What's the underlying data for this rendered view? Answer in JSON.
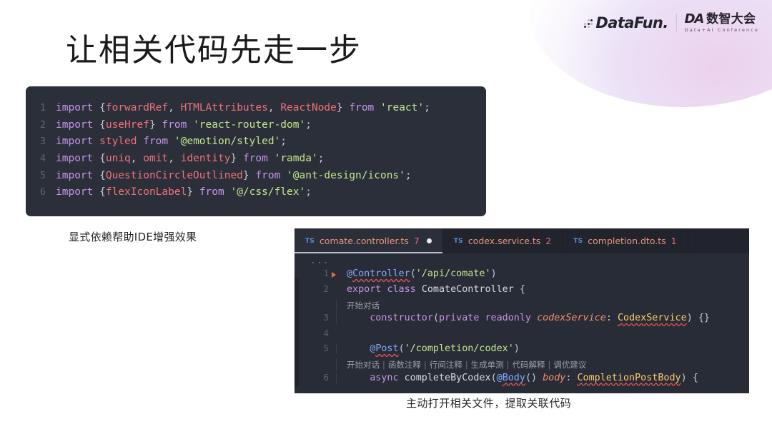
{
  "brand": {
    "datafun_name": "DataFun.",
    "da_mark": "DA",
    "da_cn": "数智大会",
    "da_sub": "Data+AI Conference"
  },
  "slide": {
    "title": "让相关代码先走一步",
    "caption_top": "显式依赖帮助IDE增强效果",
    "caption_bottom": "主动打开相关文件，提取关联代码"
  },
  "code_block_top": {
    "lines": [
      {
        "number": "1",
        "tokens": [
          {
            "text": "import ",
            "cls": "t-kw"
          },
          {
            "text": "{",
            "cls": "t-pun"
          },
          {
            "text": "forwardRef",
            "cls": "t-id"
          },
          {
            "text": ", ",
            "cls": "t-pun"
          },
          {
            "text": "HTMLAttributes",
            "cls": "t-id"
          },
          {
            "text": ", ",
            "cls": "t-pun"
          },
          {
            "text": "ReactNode",
            "cls": "t-id"
          },
          {
            "text": "} ",
            "cls": "t-pun"
          },
          {
            "text": "from ",
            "cls": "t-kw"
          },
          {
            "text": "'react'",
            "cls": "t-str"
          },
          {
            "text": ";",
            "cls": "t-pun"
          }
        ]
      },
      {
        "number": "2",
        "tokens": [
          {
            "text": "import ",
            "cls": "t-kw"
          },
          {
            "text": "{",
            "cls": "t-pun"
          },
          {
            "text": "useHref",
            "cls": "t-id"
          },
          {
            "text": "} ",
            "cls": "t-pun"
          },
          {
            "text": "from ",
            "cls": "t-kw"
          },
          {
            "text": "'react-router-dom'",
            "cls": "t-str"
          },
          {
            "text": ";",
            "cls": "t-pun"
          }
        ]
      },
      {
        "number": "3",
        "tokens": [
          {
            "text": "import ",
            "cls": "t-kw"
          },
          {
            "text": "styled ",
            "cls": "t-id"
          },
          {
            "text": "from ",
            "cls": "t-kw"
          },
          {
            "text": "'@emotion/styled'",
            "cls": "t-str"
          },
          {
            "text": ";",
            "cls": "t-pun"
          }
        ]
      },
      {
        "number": "4",
        "tokens": [
          {
            "text": "import ",
            "cls": "t-kw"
          },
          {
            "text": "{",
            "cls": "t-pun"
          },
          {
            "text": "uniq",
            "cls": "t-id"
          },
          {
            "text": ", ",
            "cls": "t-pun"
          },
          {
            "text": "omit",
            "cls": "t-id"
          },
          {
            "text": ", ",
            "cls": "t-pun"
          },
          {
            "text": "identity",
            "cls": "t-id"
          },
          {
            "text": "} ",
            "cls": "t-pun"
          },
          {
            "text": "from ",
            "cls": "t-kw"
          },
          {
            "text": "'ramda'",
            "cls": "t-str"
          },
          {
            "text": ";",
            "cls": "t-pun"
          }
        ]
      },
      {
        "number": "5",
        "tokens": [
          {
            "text": "import ",
            "cls": "t-kw"
          },
          {
            "text": "{",
            "cls": "t-pun"
          },
          {
            "text": "QuestionCircleOutlined",
            "cls": "t-id"
          },
          {
            "text": "} ",
            "cls": "t-pun"
          },
          {
            "text": "from ",
            "cls": "t-kw"
          },
          {
            "text": "'@ant-design/icons'",
            "cls": "t-str"
          },
          {
            "text": ";",
            "cls": "t-pun"
          }
        ]
      },
      {
        "number": "6",
        "tokens": [
          {
            "text": "import ",
            "cls": "t-kw"
          },
          {
            "text": "{",
            "cls": "t-pun"
          },
          {
            "text": "flexIconLabel",
            "cls": "t-id"
          },
          {
            "text": "} ",
            "cls": "t-pun"
          },
          {
            "text": "from ",
            "cls": "t-kw"
          },
          {
            "text": "'@/css/flex'",
            "cls": "t-str"
          },
          {
            "text": ";",
            "cls": "t-pun"
          }
        ]
      }
    ]
  },
  "editor": {
    "tabs": [
      {
        "badge": "TS",
        "name": "comate.controller.ts",
        "count": "7",
        "active": true,
        "dirty": true
      },
      {
        "badge": "TS",
        "name": "codex.service.ts",
        "count": "2",
        "active": false,
        "dirty": false
      },
      {
        "badge": "TS",
        "name": "completion.dto.ts",
        "count": "1",
        "active": false,
        "dirty": false
      }
    ],
    "ellipsis": "...",
    "rows": [
      {
        "kind": "code",
        "number": "1",
        "guide": false,
        "tokens": [
          {
            "text": "@",
            "cls": "t-dec"
          },
          {
            "text": "Controller",
            "cls": "t-dec squiggle"
          },
          {
            "text": "(",
            "cls": "t-pun"
          },
          {
            "text": "'/api/comate'",
            "cls": "t-str"
          },
          {
            "text": ")",
            "cls": "t-pun"
          }
        ]
      },
      {
        "kind": "code",
        "number": "2",
        "guide": false,
        "tokens": [
          {
            "text": "export ",
            "cls": "t-kw"
          },
          {
            "text": "class ",
            "cls": "t-kw"
          },
          {
            "text": "ComateController ",
            "cls": "t-plain"
          },
          {
            "text": "{",
            "cls": "t-pun"
          }
        ]
      },
      {
        "kind": "lens",
        "number": "",
        "items": [
          "开始对话"
        ]
      },
      {
        "kind": "code",
        "number": "3",
        "guide": true,
        "tokens": [
          {
            "text": "    ",
            "cls": "t-pun"
          },
          {
            "text": "constructor",
            "cls": "t-mod"
          },
          {
            "text": "(",
            "cls": "t-pun"
          },
          {
            "text": "private ",
            "cls": "t-kw"
          },
          {
            "text": "readonly ",
            "cls": "t-kw"
          },
          {
            "text": "codexService",
            "cls": "t-par"
          },
          {
            "text": ": ",
            "cls": "t-pun"
          },
          {
            "text": "CodexService",
            "cls": "t-cls squiggle"
          },
          {
            "text": ") ",
            "cls": "t-pun"
          },
          {
            "text": "{}",
            "cls": "t-pun"
          }
        ]
      },
      {
        "kind": "code",
        "number": "4",
        "guide": true,
        "tokens": []
      },
      {
        "kind": "code",
        "number": "5",
        "guide": true,
        "tokens": [
          {
            "text": "    ",
            "cls": "t-pun"
          },
          {
            "text": "@",
            "cls": "t-dec"
          },
          {
            "text": "Post",
            "cls": "t-dec squiggle"
          },
          {
            "text": "(",
            "cls": "t-pun"
          },
          {
            "text": "'/completion/codex'",
            "cls": "t-str"
          },
          {
            "text": ")",
            "cls": "t-pun"
          }
        ]
      },
      {
        "kind": "lens",
        "number": "",
        "items": [
          "开始对话",
          "函数注释",
          "行间注释",
          "生成单测",
          "代码解释",
          "调优建议"
        ]
      },
      {
        "kind": "code",
        "number": "6",
        "guide": true,
        "tokens": [
          {
            "text": "    ",
            "cls": "t-pun"
          },
          {
            "text": "async ",
            "cls": "t-kw"
          },
          {
            "text": "completeByCodex",
            "cls": "t-plain"
          },
          {
            "text": "(",
            "cls": "t-pun"
          },
          {
            "text": "@",
            "cls": "t-dec"
          },
          {
            "text": "Body",
            "cls": "t-dec squiggle"
          },
          {
            "text": "() ",
            "cls": "t-pun"
          },
          {
            "text": "body",
            "cls": "t-par"
          },
          {
            "text": ": ",
            "cls": "t-pun"
          },
          {
            "text": "CompletionPostBody",
            "cls": "t-cls squiggle"
          },
          {
            "text": ") ",
            "cls": "t-pun"
          },
          {
            "text": "{",
            "cls": "t-pun"
          }
        ]
      }
    ]
  },
  "colors": {
    "code_bg_top": "#2b2f3a",
    "editor_bg": "#282c36",
    "editor_tabbar_bg": "#21242c",
    "keyword": "#c792ea",
    "identifier": "#f07178",
    "string": "#c3e88d",
    "decorator": "#82aaff",
    "type": "#ffcb6b",
    "param": "#f78c6c",
    "error_squiggle": "#e05252",
    "codelens": "#9aa0a8"
  }
}
